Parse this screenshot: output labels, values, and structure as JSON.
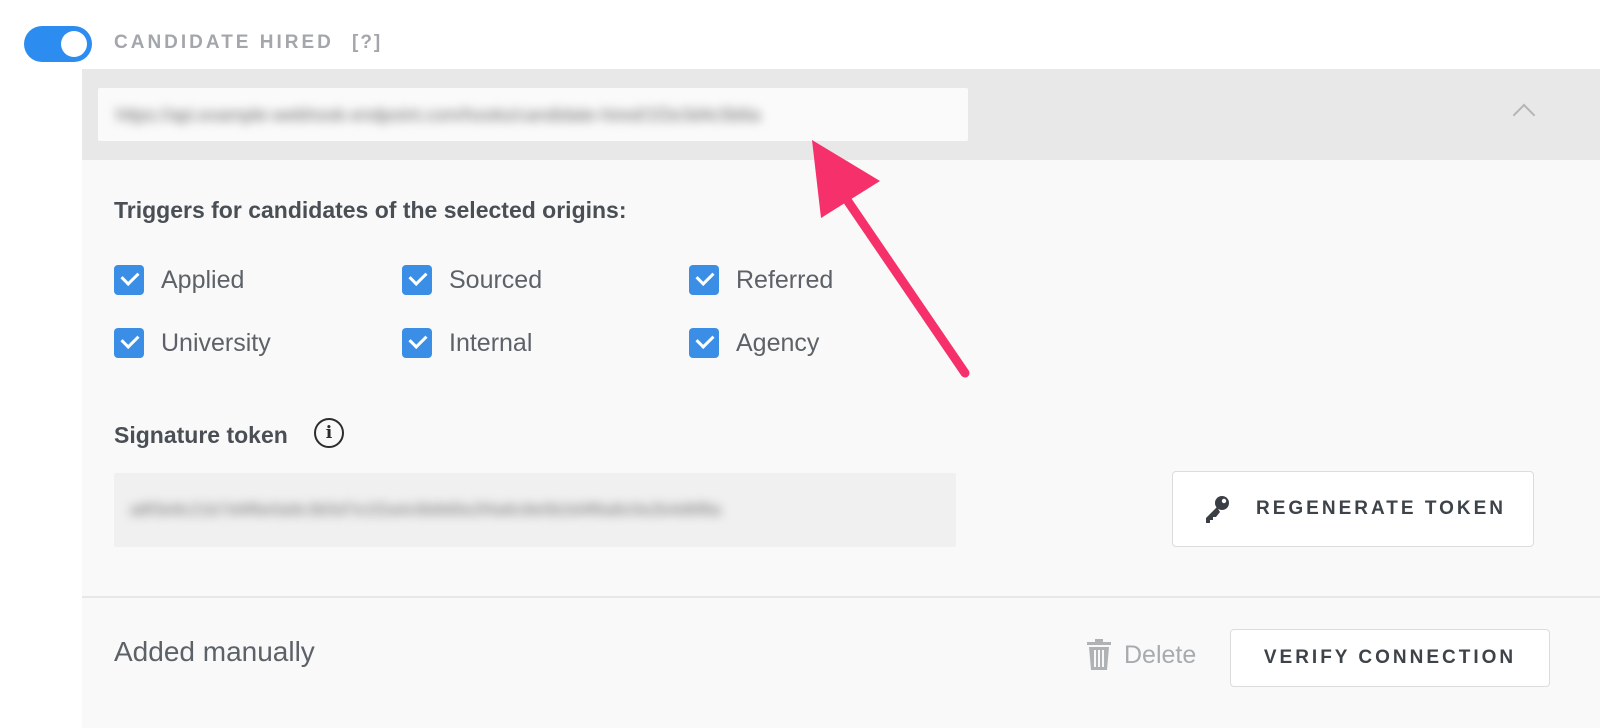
{
  "hook": {
    "enabled": true,
    "title": "CANDIDATE HIRED",
    "help": "[?]"
  },
  "endpoint": {
    "url": "https://api.example-webhook-endpoint.com/hooks/candidate-hired/1f2e3d4c5b6a"
  },
  "origins": {
    "label": "Triggers for candidates of the selected origins:",
    "items": [
      {
        "label": "Applied",
        "checked": true
      },
      {
        "label": "Sourced",
        "checked": true
      },
      {
        "label": "Referred",
        "checked": true
      },
      {
        "label": "University",
        "checked": true
      },
      {
        "label": "Internal",
        "checked": true
      },
      {
        "label": "Agency",
        "checked": true
      }
    ]
  },
  "signature": {
    "label": "Signature token",
    "value": "a8f3e9c21b7d4f6e0a9c3b5d7e1f2a4c6b8d0e2f4a6c8e0b2d4f6a8c0e2b4d6f8a",
    "regenerate_label": "REGENERATE TOKEN"
  },
  "footer": {
    "source": "Added manually",
    "delete_label": "Delete",
    "verify_label": "VERIFY CONNECTION"
  },
  "colors": {
    "accent": "#2d8cf0",
    "checkbox": "#3b8ee6",
    "annotation_arrow": "#f5306b"
  },
  "icons": [
    "toggle",
    "chevron-up-icon",
    "check-icon",
    "info-icon",
    "key-icon",
    "trash-icon"
  ]
}
